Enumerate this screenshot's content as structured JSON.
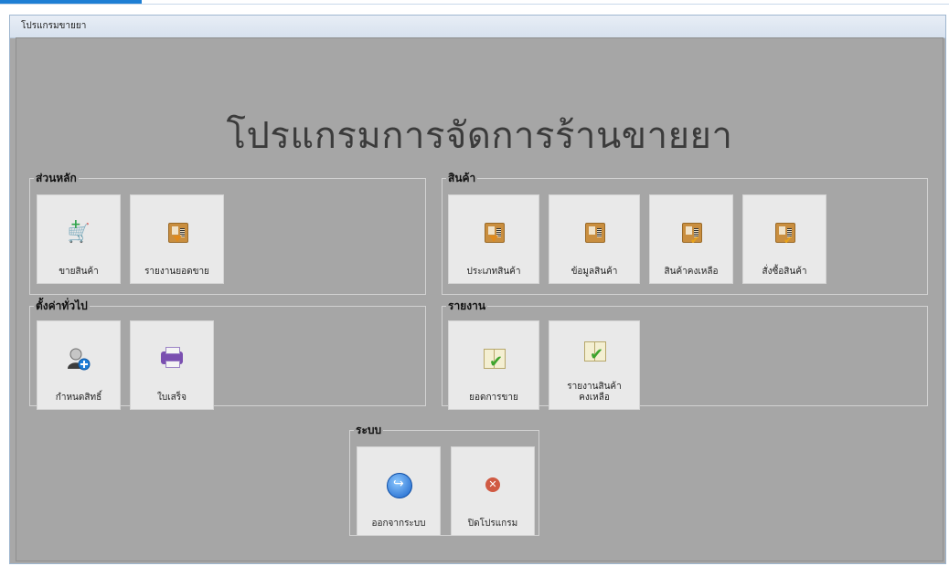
{
  "window": {
    "title": "โปรแกรมขายยา"
  },
  "app": {
    "title": "โปรแกรมการจัดการร้านขายยา"
  },
  "groups": {
    "main": {
      "title": "ส่วนหลัก",
      "tiles": [
        {
          "label": "ขายสินค้า",
          "icon": "cart-add-icon"
        },
        {
          "label": "รายงานยอดขาย",
          "icon": "box-download-icon"
        }
      ]
    },
    "products": {
      "title": "สินค้า",
      "tiles": [
        {
          "label": "ประเภทสินค้า",
          "icon": "box-download-icon"
        },
        {
          "label": "ข้อมูลสินค้า",
          "icon": "box-icon"
        },
        {
          "label": "สินค้าคงเหลือ",
          "icon": "box-check-icon"
        },
        {
          "label": "สั่งซื้อสินค้า",
          "icon": "box-check-icon"
        }
      ]
    },
    "settings": {
      "title": "ตั้งค่าทั่วไป",
      "tiles": [
        {
          "label": "กำหนดสิทธิ์",
          "icon": "add-user-icon"
        },
        {
          "label": "ใบเสร็จ",
          "icon": "printer-icon"
        }
      ]
    },
    "reports": {
      "title": "รายงาน",
      "tiles": [
        {
          "label": "ยอดการขาย",
          "icon": "book-check-icon"
        },
        {
          "label": "รายงานสินค้า คงเหลือ",
          "line1": "รายงานสินค้า",
          "line2": "คงเหลือ",
          "icon": "book-check-icon"
        }
      ]
    },
    "system": {
      "title": "ระบบ",
      "tiles": [
        {
          "label": "ออกจากระบบ",
          "icon": "logout-icon"
        },
        {
          "label": "ปิดโปรแกรม",
          "icon": "close-icon"
        }
      ]
    }
  },
  "colors": {
    "background": "#a6a6a6",
    "tile": "#e9e9e9",
    "accent": "#1e7fd4"
  }
}
